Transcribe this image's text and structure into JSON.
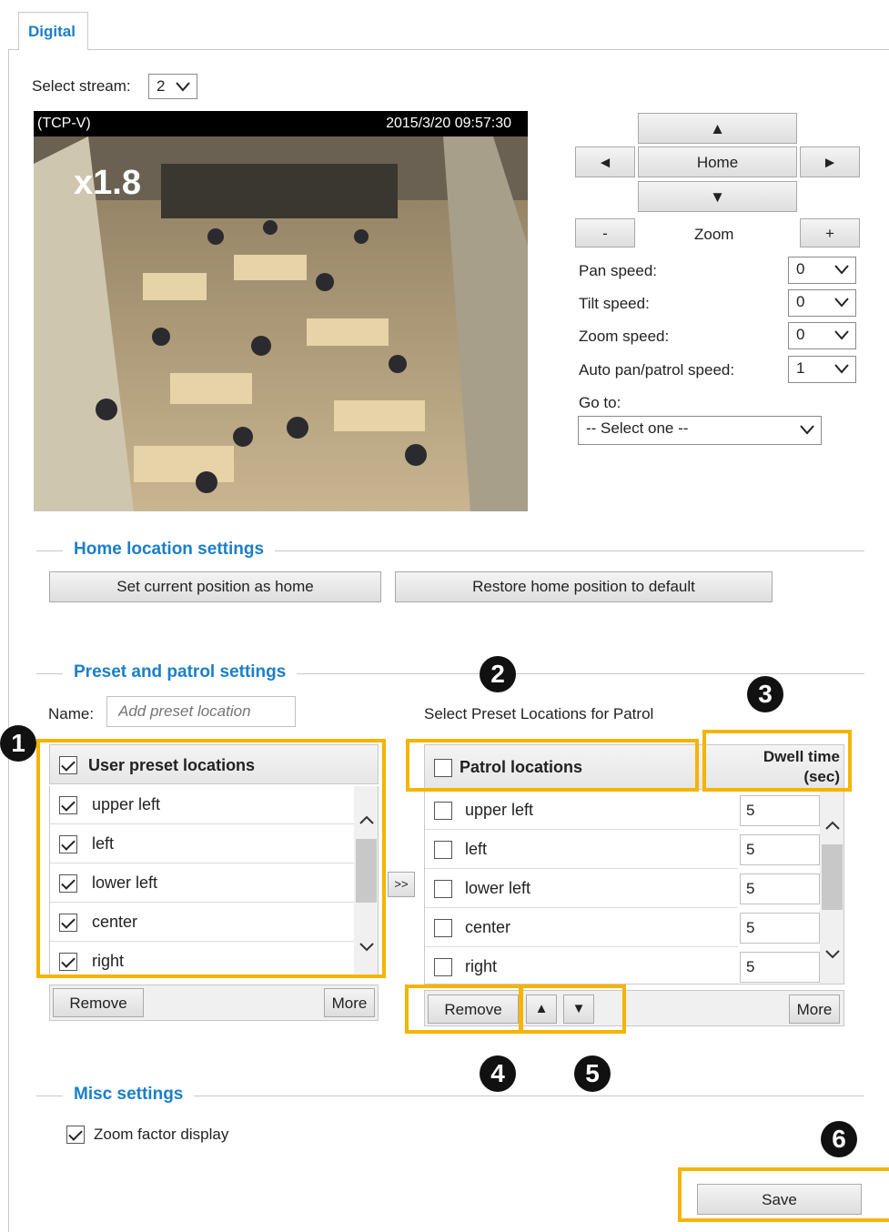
{
  "tab": {
    "label": "Digital"
  },
  "stream": {
    "label": "Select stream:",
    "value": "2"
  },
  "video": {
    "protocol": "(TCP-V)",
    "timestamp": "2015/3/20 09:57:30",
    "zoom_overlay": "x1.8"
  },
  "ptz": {
    "up": "▲",
    "left": "◄",
    "home": "Home",
    "right": "►",
    "down": "▼",
    "zoom_out": "-",
    "zoom_label": "Zoom",
    "zoom_in": "+",
    "pan_speed_label": "Pan speed:",
    "pan_speed_value": "0",
    "tilt_speed_label": "Tilt speed:",
    "tilt_speed_value": "0",
    "zoom_speed_label": "Zoom speed:",
    "zoom_speed_value": "0",
    "auto_speed_label": "Auto pan/patrol speed:",
    "auto_speed_value": "1",
    "goto_label": "Go to:",
    "goto_value": "-- Select one --"
  },
  "home_section": {
    "title": "Home location settings",
    "set_home": "Set current position as home",
    "restore_home": "Restore home position to default"
  },
  "preset_section": {
    "title": "Preset and patrol settings",
    "name_label": "Name:",
    "name_placeholder": "Add preset location",
    "patrol_caption": "Select Preset Locations for Patrol",
    "user_header": "User preset locations",
    "user_items": [
      "upper left",
      "left",
      "lower left",
      "center",
      "right"
    ],
    "transfer": ">>",
    "patrol_header": "Patrol locations",
    "dwell_header_1": "Dwell time",
    "dwell_header_2": "(sec)",
    "patrol_items": [
      {
        "label": "upper left",
        "dwell": "5"
      },
      {
        "label": "left",
        "dwell": "5"
      },
      {
        "label": "lower left",
        "dwell": "5"
      },
      {
        "label": "center",
        "dwell": "5"
      },
      {
        "label": "right",
        "dwell": "5"
      }
    ],
    "remove": "Remove",
    "more": "More",
    "move_up": "▲",
    "move_down": "▼"
  },
  "misc_section": {
    "title": "Misc settings",
    "zoom_display": "Zoom factor display"
  },
  "save": "Save",
  "badges": [
    "1",
    "2",
    "3",
    "4",
    "5",
    "6"
  ],
  "colors": {
    "accent": "#1a7fc8",
    "highlight": "#f5b400"
  }
}
